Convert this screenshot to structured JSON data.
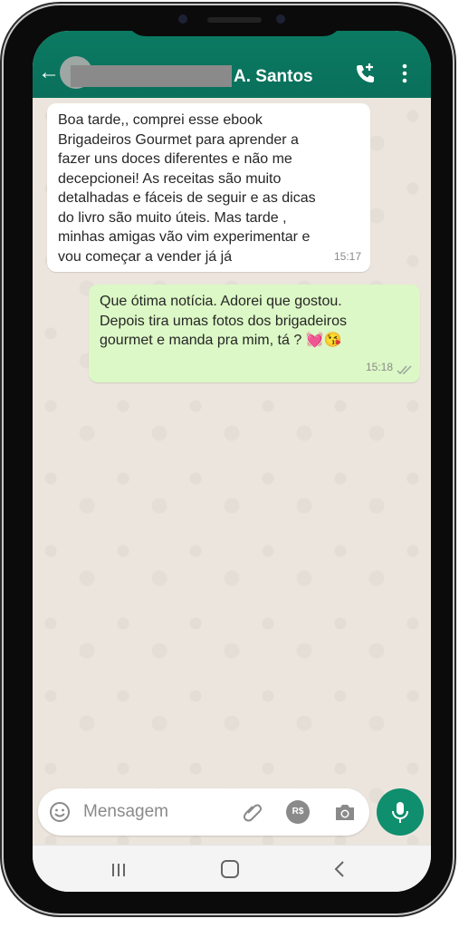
{
  "header": {
    "back_icon": "arrow-left-icon",
    "contact_name": "A. Santos",
    "call_icon": "add-call-icon",
    "menu_icon": "more-vertical-icon",
    "color": "#0a705b"
  },
  "messages": [
    {
      "direction": "incoming",
      "text": "Boa tarde,, comprei esse ebook\nBrigadeiros Gourmet para aprender a\nfazer uns doces diferentes e não me\ndecepcionei! As receitas são muito\ndetalhadas e fáceis de seguir e as dicas\ndo livro são muito úteis. Mas tarde ,\nminhas amigas vão vim experimentar e\nvou começar a vender já já",
      "time": "15:17"
    },
    {
      "direction": "outgoing",
      "text": "Que ótima notícia. Adorei que gostou.\nDepois tira umas fotos dos brigadeiros\ngourmet e manda pra mim, tá ? ",
      "emojis": [
        "💓",
        "😘"
      ],
      "time": "15:18",
      "status_icon": "double-check-icon"
    }
  ],
  "composer": {
    "placeholder": "Mensagem",
    "emoji_icon": "smiley-icon",
    "attach_icon": "paperclip-icon",
    "payment_label": "R$",
    "camera_icon": "camera-icon",
    "mic_icon": "microphone-icon",
    "accent": "#0f8f6e"
  },
  "system_nav": {
    "recents_icon": "recents-icon",
    "home_icon": "home-icon",
    "back_icon": "chevron-left-icon"
  }
}
